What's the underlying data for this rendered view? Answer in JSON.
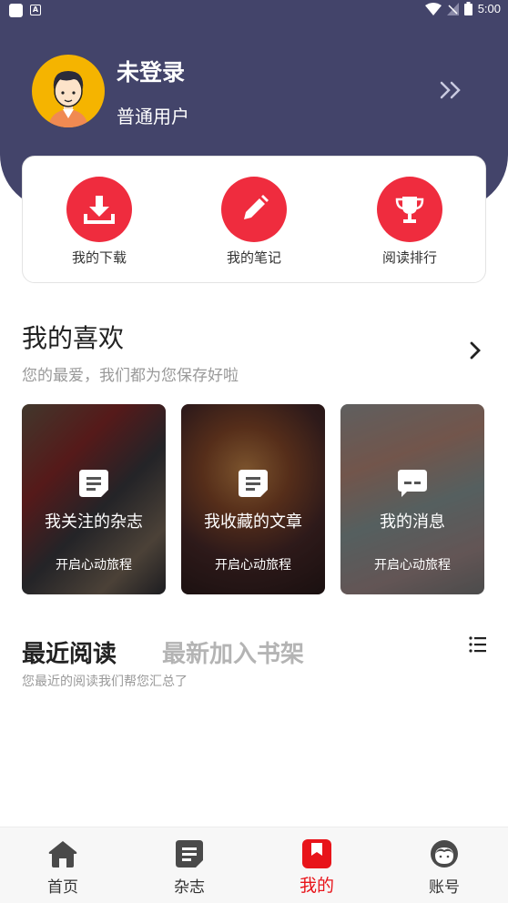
{
  "status_bar": {
    "time": "5:00"
  },
  "profile": {
    "name": "未登录",
    "type": "普通用户"
  },
  "quick_actions": [
    {
      "label": "我的下载",
      "icon": "download-icon"
    },
    {
      "label": "我的笔记",
      "icon": "pencil-icon"
    },
    {
      "label": "阅读排行",
      "icon": "trophy-icon"
    }
  ],
  "favorites": {
    "title": "我的喜欢",
    "subtitle": "您的最爱，我们都为您保存好啦",
    "cards": [
      {
        "name": "我关注的杂志",
        "cta": "开启心动旅程",
        "icon": "document-icon"
      },
      {
        "name": "我收藏的文章",
        "cta": "开启心动旅程",
        "icon": "document-icon"
      },
      {
        "name": "我的消息",
        "cta": "开启心动旅程",
        "icon": "message-icon"
      }
    ]
  },
  "reading": {
    "tabs": [
      "最近阅读",
      "最新加入书架"
    ],
    "subtitle": "您最近的阅读我们帮您汇总了"
  },
  "bottom_nav": [
    {
      "label": "首页",
      "icon": "home-icon"
    },
    {
      "label": "杂志",
      "icon": "magazine-icon"
    },
    {
      "label": "我的",
      "icon": "bookmark-icon",
      "active": true
    },
    {
      "label": "账号",
      "icon": "face-icon"
    }
  ],
  "colors": {
    "header": "#43446a",
    "accent": "#ef2c3e",
    "active_nav": "#e8141a"
  }
}
